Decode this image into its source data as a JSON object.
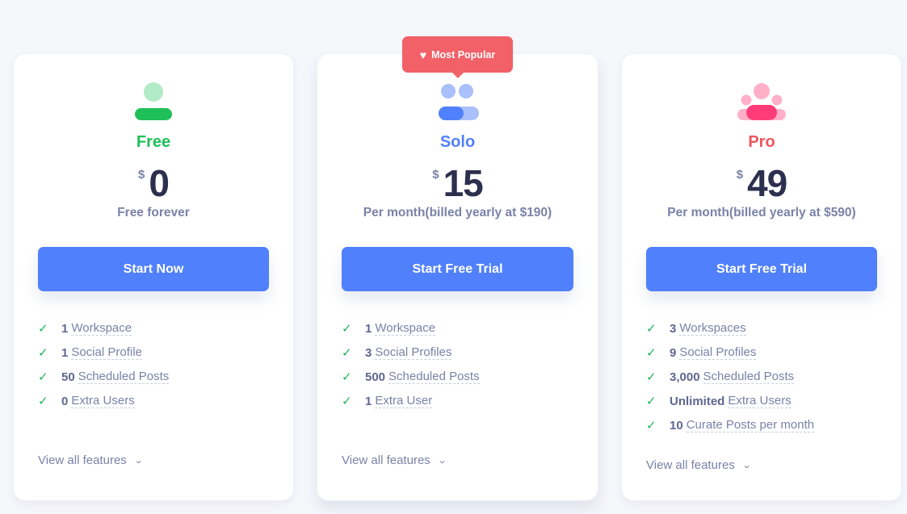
{
  "badge": {
    "icon": "heart-icon",
    "label": "Most Popular"
  },
  "plans": [
    {
      "id": "free",
      "icon": "single-user-icon",
      "name": "Free",
      "color": "#1fbf5a",
      "currency": "$",
      "price": "0",
      "period": "Free forever",
      "cta": "Start Now",
      "features": [
        {
          "num": "1",
          "label": "Workspace"
        },
        {
          "num": "1",
          "label": "Social Profile"
        },
        {
          "num": "50",
          "label": "Scheduled Posts"
        },
        {
          "num": "0",
          "label": "Extra Users"
        }
      ],
      "more": "View all features"
    },
    {
      "id": "solo",
      "icon": "two-users-icon",
      "name": "Solo",
      "color": "#5080fb",
      "currency": "$",
      "price": "15",
      "period": "Per month(billed yearly at $190)",
      "cta": "Start Free Trial",
      "features": [
        {
          "num": "1",
          "label": "Workspace"
        },
        {
          "num": "3",
          "label": "Social Profiles"
        },
        {
          "num": "500",
          "label": "Scheduled Posts"
        },
        {
          "num": "1",
          "label": "Extra User"
        }
      ],
      "more": "View all features"
    },
    {
      "id": "pro",
      "icon": "team-icon",
      "name": "Pro",
      "color": "#f0555e",
      "currency": "$",
      "price": "49",
      "period": "Per month(billed yearly at $590)",
      "cta": "Start Free Trial",
      "features": [
        {
          "num": "3",
          "label": "Workspaces"
        },
        {
          "num": "9",
          "label": "Social Profiles"
        },
        {
          "num": "3,000",
          "label": "Scheduled Posts"
        },
        {
          "num": "Unlimited",
          "label": "Extra Users"
        },
        {
          "num": "10",
          "label": "Curate Posts per month"
        }
      ],
      "more": "View all features"
    }
  ],
  "colors": {
    "primary_button": "#5080fb",
    "check": "#22b35e",
    "badge": "#f26168",
    "price_text": "#2d2f4e",
    "muted_text": "#7a82a8"
  }
}
